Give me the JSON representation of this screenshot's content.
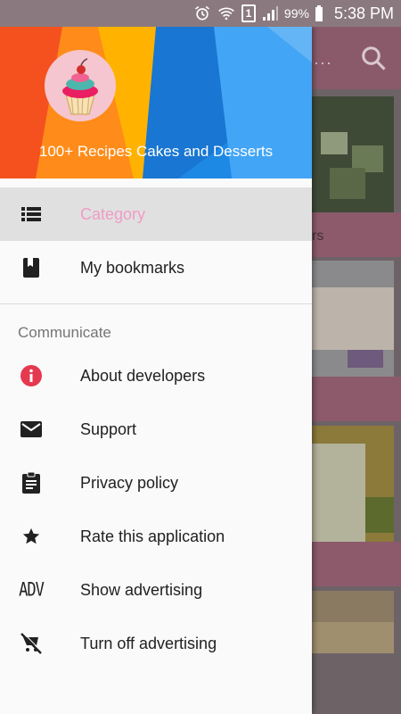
{
  "status_bar": {
    "battery": "99%",
    "time": "5:38 PM",
    "sim": "1"
  },
  "drawer": {
    "app_name": "100+ Recipes Cakes and Desserts",
    "items": [
      {
        "label": "Category",
        "icon": "list-icon",
        "active": true
      },
      {
        "label": "My bookmarks",
        "icon": "bookmark-icon",
        "active": false
      }
    ],
    "section_title": "Communicate",
    "communicate_items": [
      {
        "label": "About developers",
        "icon": "info-icon"
      },
      {
        "label": "Support",
        "icon": "mail-icon"
      },
      {
        "label": "Privacy policy",
        "icon": "clipboard-icon"
      },
      {
        "label": "Rate this application",
        "icon": "star-icon"
      },
      {
        "label": "Show advertising",
        "icon": "adv-icon",
        "icon_text": "ADV"
      },
      {
        "label": "Turn off advertising",
        "icon": "remove-cart-icon"
      }
    ]
  },
  "background": {
    "partial_label": "rs"
  },
  "colors": {
    "active_text": "#f09cc4",
    "toolbar": "#8a5a6b",
    "info_red": "#e53950"
  }
}
